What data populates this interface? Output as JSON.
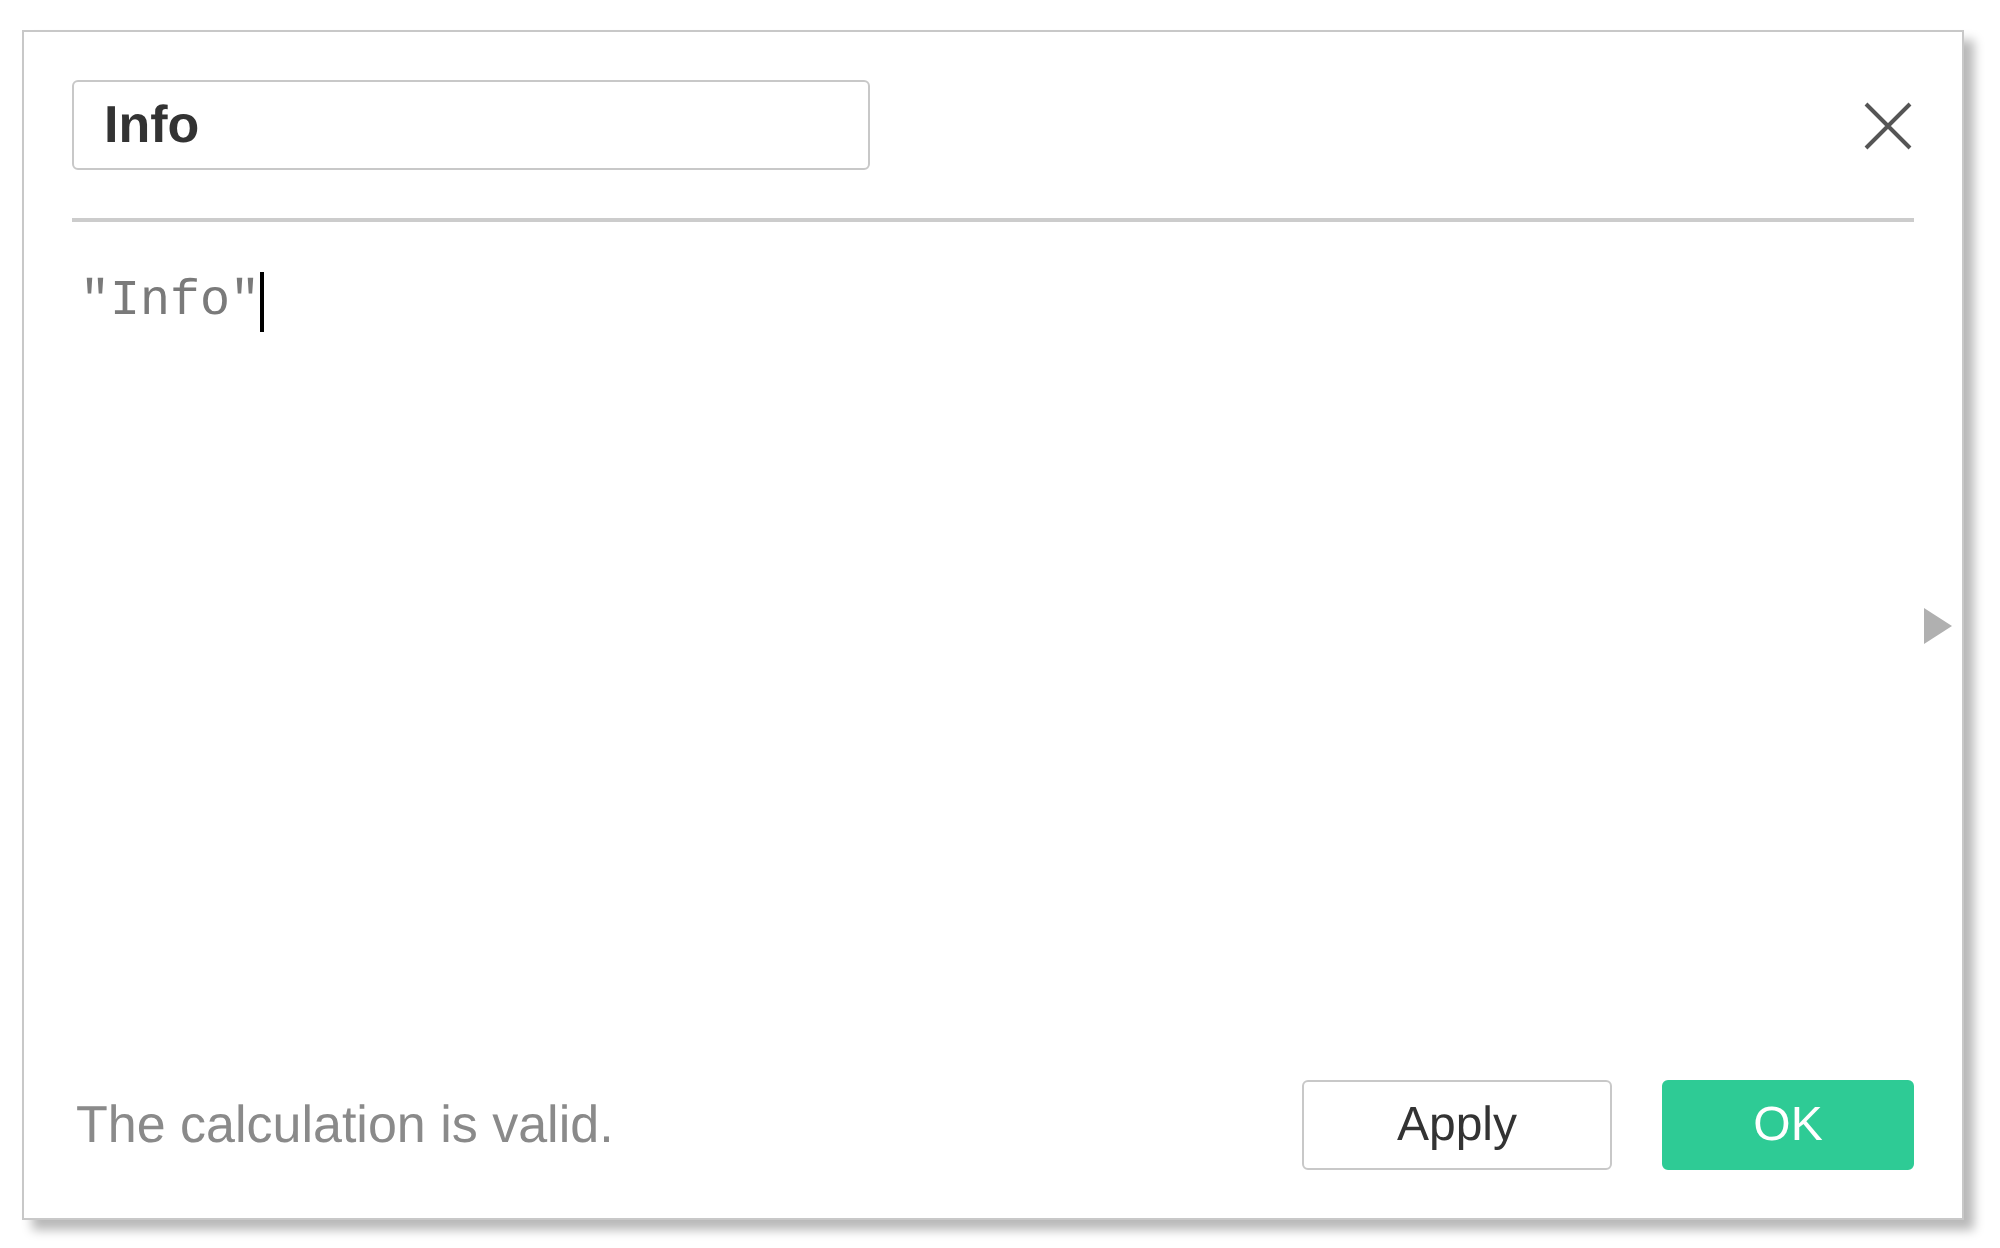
{
  "dialog": {
    "name_field": {
      "value": "Info"
    },
    "formula_editor": {
      "text": "\"Info\"",
      "focused": true
    },
    "side_panel": {
      "expanded": false
    },
    "status": {
      "text": "The calculation is valid."
    },
    "buttons": [
      {
        "label": "Apply",
        "kind": "secondary"
      },
      {
        "label": "OK",
        "kind": "primary"
      }
    ]
  }
}
